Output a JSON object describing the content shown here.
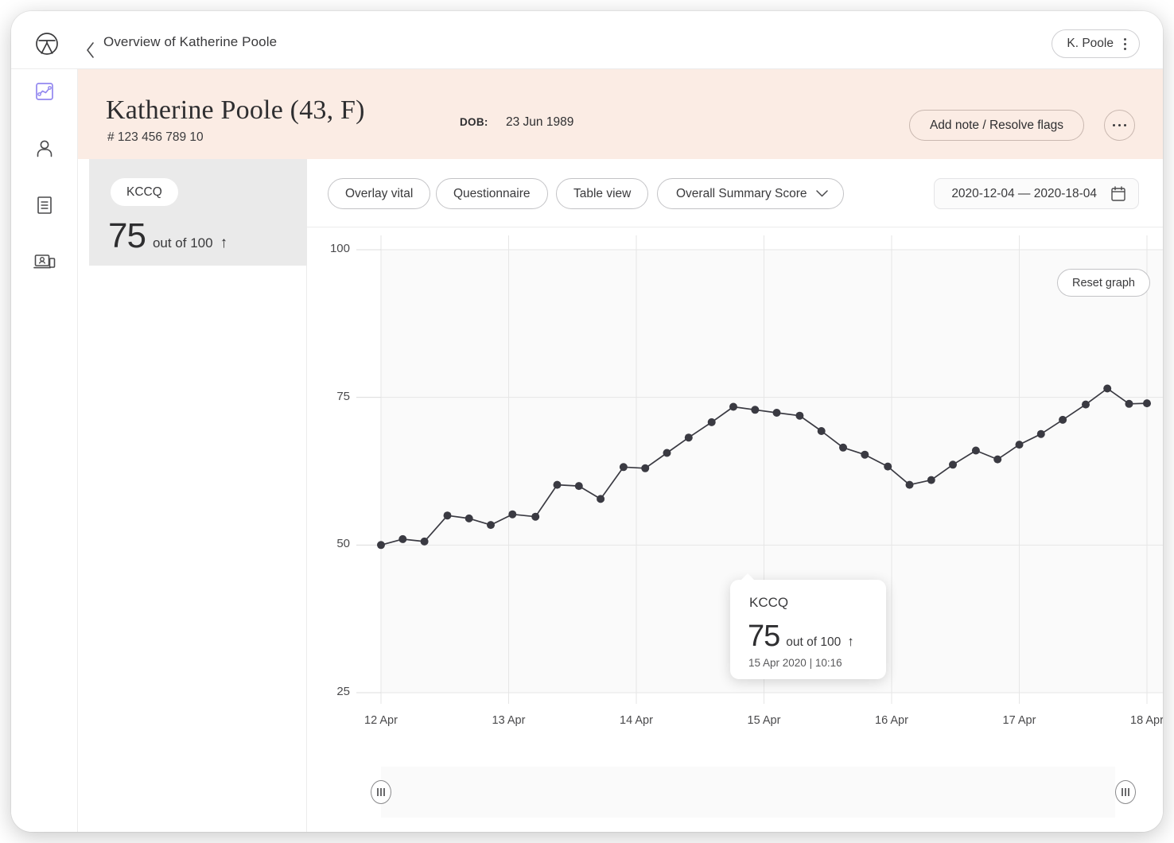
{
  "topbar": {
    "logo_icon": "clinic-logo-icon",
    "back_icon": "back-chevron-icon",
    "title": "Overview of Katherine Poole",
    "user_name": "K. Poole",
    "user_menu_icon": "kebab-menu-icon"
  },
  "sidebar": {
    "items": [
      {
        "icon": "line-chart-icon",
        "name": "trends",
        "active": true
      },
      {
        "icon": "person-icon",
        "name": "profile",
        "active": false
      },
      {
        "icon": "document-icon",
        "name": "notes",
        "active": false
      },
      {
        "icon": "video-consult-icon",
        "name": "consultations",
        "active": false
      }
    ],
    "active_color": "#9287ef"
  },
  "banner": {
    "patient_name": "Katherine Poole (43, F)",
    "patient_id": "# 123 456 789 10",
    "dob_label": "DOB:",
    "dob_value": "23 Jun 1989",
    "add_note_label": "Add note / Resolve flags",
    "more_icon": "ellipsis-icon",
    "background": "#fbece4"
  },
  "score_card": {
    "chip_label": "KCCQ",
    "value": "75",
    "out_of": "out of 100",
    "trend_arrow": "↑",
    "selected": true
  },
  "toolbar": {
    "overlay_vital": "Overlay vital",
    "questionnaire": "Questionnaire",
    "table_view": "Table view",
    "score_select": "Overall Summary Score",
    "score_select_icon": "chevron-down-icon",
    "date_range": "2020-12-04 — 2020-18-04",
    "calendar_icon": "calendar-icon"
  },
  "graph": {
    "reset_label": "Reset graph",
    "scrub_left_handle_icon": "drag-handle-icon",
    "scrub_right_handle_icon": "drag-handle-icon"
  },
  "tooltip": {
    "title": "KCCQ",
    "value": "75",
    "out_of": "out of 100",
    "trend_arrow": "↑",
    "timestamp": "15 Apr 2020 | 10:16"
  },
  "chart_data": {
    "type": "line",
    "title": "KCCQ Overall Summary Score",
    "xlabel": "",
    "ylabel": "",
    "ylim": [
      25,
      100
    ],
    "yticks": [
      25,
      50,
      75,
      100
    ],
    "ytick_labels": [
      "25",
      "50",
      "75",
      "100"
    ],
    "xticks": [
      "12 Apr",
      "13 Apr",
      "14 Apr",
      "15 Apr",
      "16 Apr",
      "17 Apr",
      "18 Apr"
    ],
    "xlim": [
      "12 Apr",
      "18 Apr"
    ],
    "grid": true,
    "legend": false,
    "marker": "circle",
    "color": "#3a3a42",
    "series": [
      {
        "name": "KCCQ",
        "x": [
          0.0,
          0.17,
          0.34,
          0.52,
          0.69,
          0.86,
          1.03,
          1.21,
          1.38,
          1.55,
          1.72,
          1.9,
          2.07,
          2.24,
          2.41,
          2.59,
          2.76,
          2.93,
          3.1,
          3.28,
          3.45,
          3.62,
          3.79,
          3.97,
          4.14,
          4.31,
          4.48,
          4.66,
          4.83,
          5.0,
          5.17,
          5.34,
          5.52,
          5.69,
          5.86,
          6.0
        ],
        "values": [
          50.0,
          51.0,
          50.6,
          55.0,
          54.5,
          53.4,
          55.2,
          54.8,
          60.2,
          60.0,
          57.8,
          63.2,
          63.0,
          65.6,
          68.2,
          70.8,
          73.4,
          72.9,
          72.4,
          71.9,
          69.3,
          66.5,
          65.3,
          63.3,
          60.2,
          61.0,
          63.6,
          66.0,
          64.5,
          67.0,
          68.8,
          71.2,
          73.8,
          76.5,
          73.9,
          74.0
        ]
      }
    ],
    "highlight_point": {
      "x": "15 Apr",
      "y": 75,
      "label": "75 out of 100",
      "timestamp": "15 Apr 2020 | 10:16"
    }
  }
}
